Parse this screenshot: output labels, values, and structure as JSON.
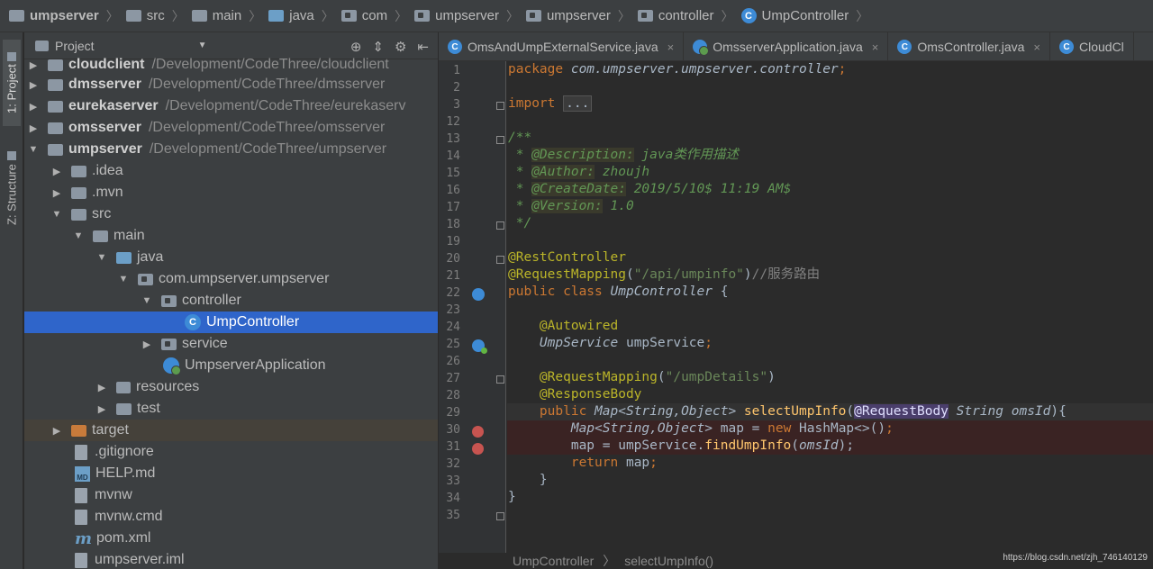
{
  "breadcrumb": {
    "items": [
      "umpserver",
      "src",
      "main",
      "java",
      "com",
      "umpserver",
      "umpserver",
      "controller",
      "UmpController"
    ]
  },
  "tool_strip": {
    "project_tab": "1: Project",
    "structure_tab": "Z: Structure"
  },
  "project_panel": {
    "title": "Project",
    "dropdown": "▼",
    "tools": [
      "⊕",
      "⇕",
      "⚙",
      "⇤"
    ]
  },
  "tree": [
    {
      "label": "cloudclient",
      "path": "/Development/CodeThree/cloudclient",
      "bold": true
    },
    {
      "label": "dmsserver",
      "path": "/Development/CodeThree/dmsserver",
      "bold": true
    },
    {
      "label": "eurekaserver",
      "path": "/Development/CodeThree/eurekaserv",
      "bold": true
    },
    {
      "label": "omsserver",
      "path": "/Development/CodeThree/omsserver",
      "bold": true
    },
    {
      "label": "umpserver",
      "path": "/Development/CodeThree/umpserver",
      "bold": true
    },
    {
      "label": ".idea"
    },
    {
      "label": ".mvn"
    },
    {
      "label": "src"
    },
    {
      "label": "main"
    },
    {
      "label": "java"
    },
    {
      "label": "com.umpserver.umpserver"
    },
    {
      "label": "controller"
    },
    {
      "label": "UmpController"
    },
    {
      "label": "service"
    },
    {
      "label": "UmpserverApplication"
    },
    {
      "label": "resources"
    },
    {
      "label": "test"
    },
    {
      "label": "target"
    },
    {
      "label": ".gitignore"
    },
    {
      "label": "HELP.md"
    },
    {
      "label": "mvnw"
    },
    {
      "label": "mvnw.cmd"
    },
    {
      "label": "pom.xml"
    },
    {
      "label": "umpserver.iml"
    }
  ],
  "tabs": [
    {
      "label": "OmsAndUmpExternalService.java",
      "close": "×"
    },
    {
      "label": "OmsserverApplication.java",
      "close": "×"
    },
    {
      "label": "OmsController.java",
      "close": "×"
    },
    {
      "label": "CloudCl"
    }
  ],
  "line_numbers": [
    "1",
    "2",
    "3",
    "12",
    "13",
    "14",
    "15",
    "16",
    "17",
    "18",
    "19",
    "20",
    "21",
    "22",
    "23",
    "24",
    "25",
    "26",
    "27",
    "28",
    "29",
    "30",
    "31",
    "32",
    "33",
    "34",
    "35"
  ],
  "code": {
    "l1_kw": "package",
    "l1_pkg": " com.umpserver.umpserver.controller",
    "l1_semi": ";",
    "l3_kw": "import",
    "l3_dots": "...",
    "l13": "/**",
    "l14_pre": " * ",
    "l14_tag": "@Description:",
    "l14_txt": " java类作用描述",
    "l15_tag": "@Author:",
    "l15_txt": " zhoujh",
    "l16_tag": "@CreateDate:",
    "l16_txt": " 2019/5/10$ 11:19 AM$",
    "l17_tag": "@Version:",
    "l17_txt": " 1.0",
    "l18": " */",
    "l20": "@RestController",
    "l21_ann": "@RequestMapping",
    "l21_str": "\"/api/umpinfo\"",
    "l21_cm": "//服务路由",
    "l22_kw": "public class ",
    "l22_cls": "UmpController",
    "l22_br": " {",
    "l24": "@Autowired",
    "l25_typ": "UmpService",
    "l25_var": " umpService",
    "l25_semi": ";",
    "l27_ann": "@RequestMapping",
    "l27_str": "\"/umpDetails\"",
    "l28": "@ResponseBody",
    "l29_kw": "public ",
    "l29_map": "Map",
    "l29_gen": "<String,Object>",
    "l29_fn": " selectUmpInfo",
    "l29_ann": "@RequestBody",
    "l29_typ": " String",
    "l29_param": " omsId",
    "l29_end": "){",
    "l30_map": "Map",
    "l30_gen": "<String,Object>",
    "l30_var": " map = ",
    "l30_new": "new",
    "l30_hm": " HashMap<>()",
    "l30_semi": ";",
    "l31_var": "map = umpService.",
    "l31_fn": "findUmpInfo",
    "l31_param": "omsId",
    "l31_end": ");",
    "l32_kw": "return",
    "l32_txt": " map",
    "l32_semi": ";",
    "l33": "}",
    "l34": "}"
  },
  "editor_crumbs": {
    "cls": "UmpController",
    "sep": "〉",
    "method": "selectUmpInfo()"
  },
  "watermark": "https://blog.csdn.net/zjh_746140129"
}
